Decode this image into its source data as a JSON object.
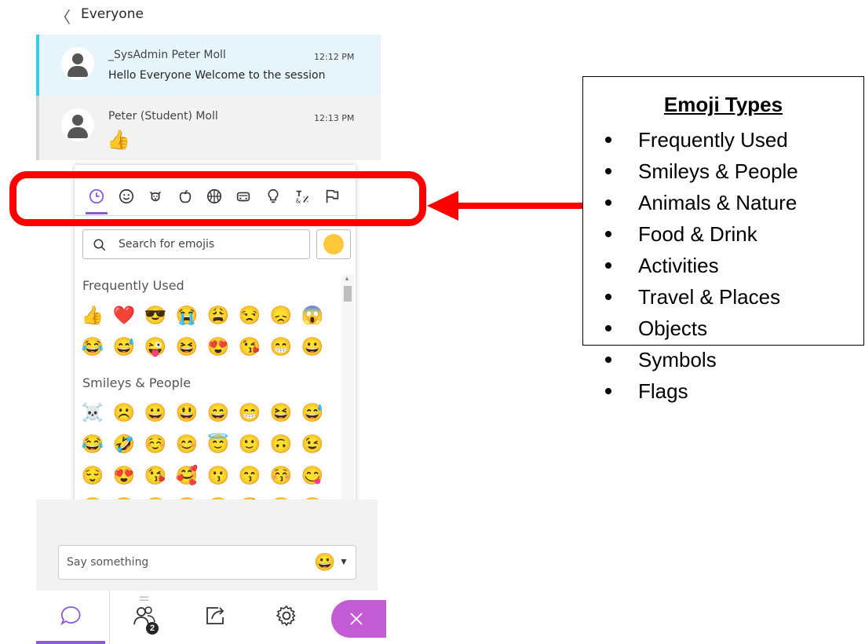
{
  "header": {
    "back_glyph": "〈",
    "title": "Everyone"
  },
  "messages": [
    {
      "sender": "_SysAdmin Peter Moll",
      "time": "12:12 PM",
      "text": "Hello Everyone Welcome to the session"
    },
    {
      "sender": "Peter (Student) Moll",
      "time": "12:13 PM",
      "text": "👍"
    }
  ],
  "picker": {
    "categories": [
      "frequently-used",
      "smileys-people",
      "animals-nature",
      "food-drink",
      "activities",
      "travel-places",
      "objects",
      "symbols",
      "flags"
    ],
    "active_category": "frequently-used",
    "search_placeholder": "Search for emojis",
    "skin_tone_color": "#ffc83d",
    "sections": [
      {
        "title": "Frequently Used",
        "rows": [
          [
            "👍",
            "❤️",
            "😎",
            "😭",
            "😩",
            "😒",
            "😞",
            "😱"
          ],
          [
            "😂",
            "😅",
            "😜",
            "😆",
            "😍",
            "😘",
            "😁",
            "😀"
          ]
        ]
      },
      {
        "title": "Smileys & People",
        "rows": [
          [
            "☠️",
            "☹️",
            "😀",
            "😃",
            "😄",
            "😁",
            "😆",
            "😅"
          ],
          [
            "😂",
            "🤣",
            "☺️",
            "😊",
            "😇",
            "🙂",
            "🙃",
            "😉"
          ],
          [
            "😌",
            "😍",
            "😘",
            "🥰",
            "😗",
            "😙",
            "😚",
            "😋"
          ],
          [
            "😛",
            "😝",
            "😜",
            "🤪",
            "🤨",
            "🧐",
            "🤓",
            "😎"
          ]
        ]
      }
    ]
  },
  "legend": {
    "title": "Emoji Types",
    "items": [
      "Frequently Used",
      "Smileys & People",
      "Animals & Nature",
      "Food & Drink",
      "Activities",
      "Travel & Places",
      "Objects",
      "Symbols",
      "Flags"
    ]
  },
  "composer": {
    "placeholder": "Say something",
    "emoji_button": "😀",
    "caret": "▼"
  },
  "bottombar": {
    "tabs": [
      "chat",
      "attendees",
      "share-content",
      "settings",
      "close"
    ],
    "attendee_count": "2"
  },
  "colors": {
    "accent": "#8c5bd8",
    "highlight_red": "#ff0000",
    "close_purple": "#c35dd6",
    "selected_msg": "#e6f5fb",
    "selected_bar": "#3ec6ee"
  }
}
